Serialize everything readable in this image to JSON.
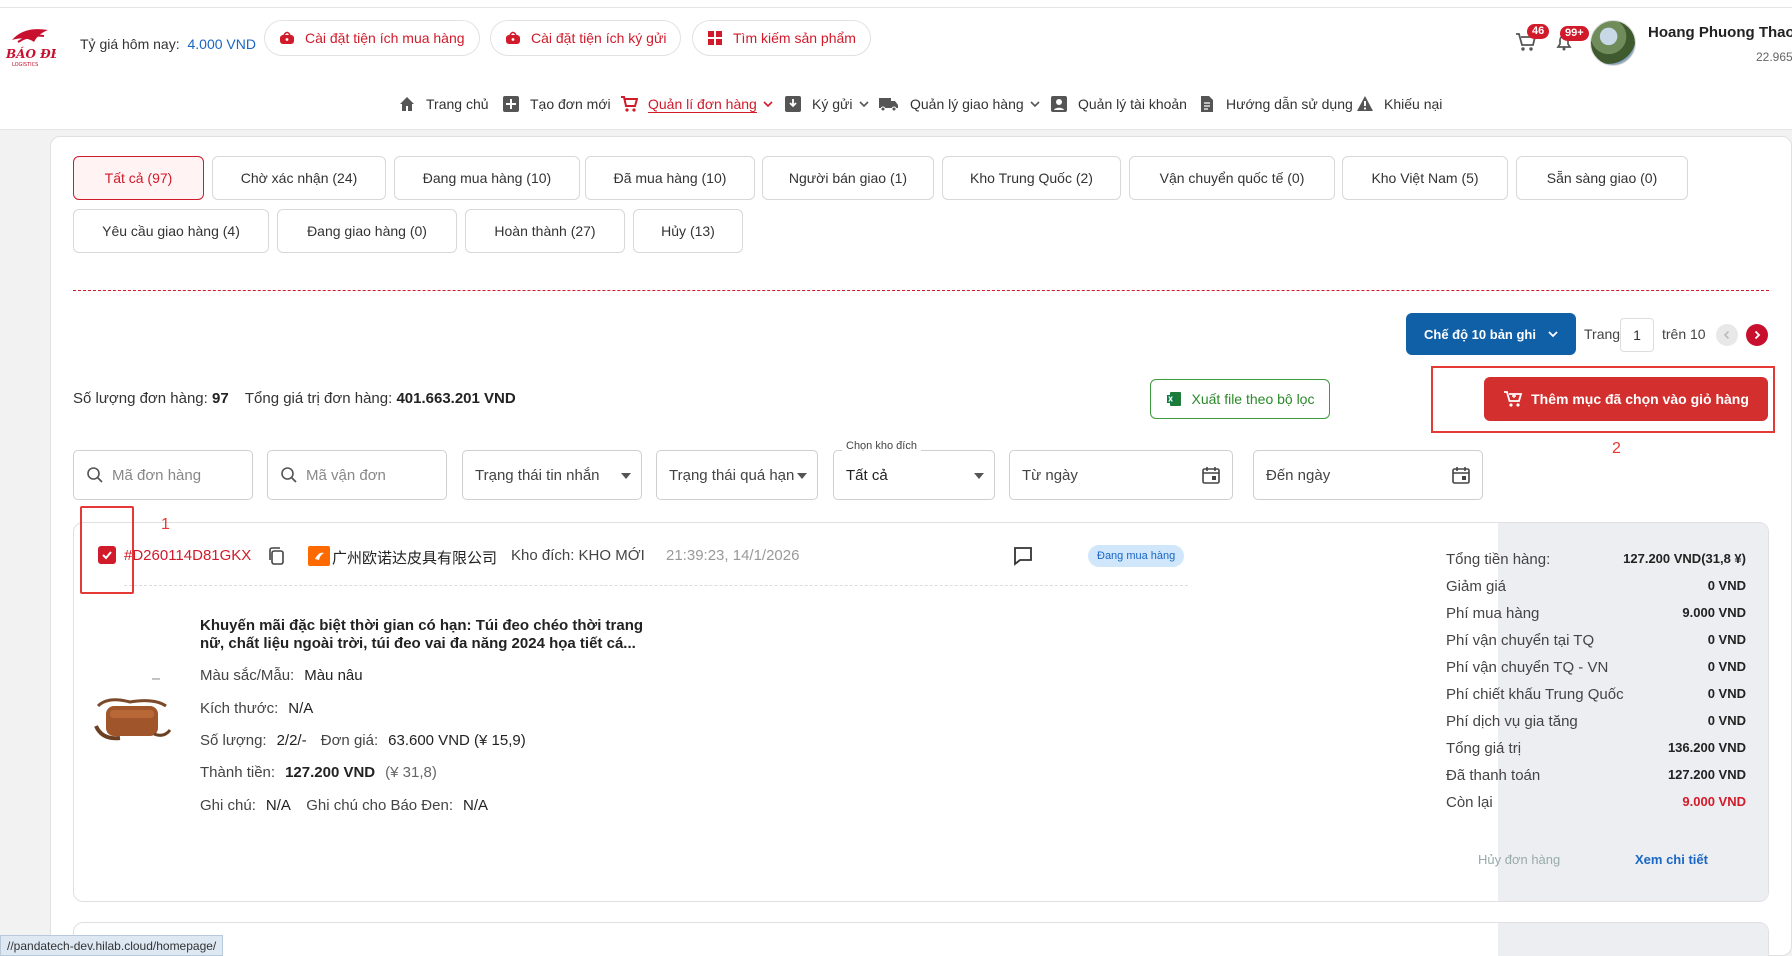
{
  "header": {
    "exchange_label": "Tỷ giá hôm nay:",
    "exchange_value": "4.000 VND",
    "pills": [
      "Cài đặt tiện ích mua hàng",
      "Cài đặt tiện ích ký gửi",
      "Tìm kiếm sản phẩm"
    ],
    "cart_badge": "46",
    "bell_badge": "99+",
    "username": "Hoang Phuong Thao",
    "balance": "22.965"
  },
  "nav": [
    {
      "label": "Trang chủ",
      "icon": "home-icon"
    },
    {
      "label": "Tạo đơn mới",
      "icon": "plus-square-icon"
    },
    {
      "label": "Quản lí đơn hàng",
      "icon": "cart-icon"
    },
    {
      "label": "Ký gửi",
      "icon": "download-box-icon"
    },
    {
      "label": "Quản lý giao hàng",
      "icon": "truck-icon"
    },
    {
      "label": "Quản lý tài khoản",
      "icon": "account-icon"
    },
    {
      "label": "Hướng dẫn sử dụng",
      "icon": "document-icon"
    },
    {
      "label": "Khiếu nại",
      "icon": "warning-icon"
    }
  ],
  "tabs": [
    "Tất cả (97)",
    "Chờ xác nhận (24)",
    "Đang mua hàng (10)",
    "Đã mua hàng (10)",
    "Người bán giao (1)",
    "Kho Trung Quốc (2)",
    "Vận chuyển quốc tế (0)",
    "Kho Việt Nam (5)",
    "Sẵn sàng giao (0)",
    "Yêu cầu giao hàng (4)",
    "Đang giao hàng (0)",
    "Hoàn thành (27)",
    "Hủy (13)"
  ],
  "pagination": {
    "mode_label": "Chế độ 10 bản ghi",
    "page_label": "Trang",
    "page_value": "1",
    "total_label": "trên 10"
  },
  "summary": {
    "count_label": "Số lượng đơn hàng:",
    "count_value": "97",
    "total_label": "Tổng giá trị đơn hàng:",
    "total_value": "401.663.201 VND"
  },
  "actions": {
    "export_label": "Xuất file theo bộ lọc",
    "add_cart_label": "Thêm mục đã chọn vào giỏ hàng"
  },
  "annotations": {
    "one": "1",
    "two": "2"
  },
  "filters": {
    "order_code_placeholder": "Mã đơn hàng",
    "tracking_placeholder": "Mã vận đơn",
    "message_status": "Trạng thái tin nhắn",
    "overdue_status": "Trạng thái quá hạn",
    "warehouse_legend": "Chọn kho đích",
    "warehouse_value": "Tất cả",
    "from_date": "Từ ngày",
    "to_date": "Đến ngày"
  },
  "order": {
    "id": "#D260114D81GKX",
    "shop_name": "广州欧诺达皮具有限公司",
    "destination": "Kho đích: KHO MỚI",
    "time": "21:39:23, 14/1/2026",
    "status": "Đang mua hàng",
    "product_title_1": "Khuyến mãi đặc biệt thời gian có hạn: Túi đeo chéo thời trang",
    "product_title_2": "nữ, chất liệu ngoài trời, túi đeo vai đa năng 2024 họa tiết cá...",
    "color_label": "Màu sắc/Mẫu:",
    "color_value": "Màu nâu",
    "size_label": "Kích thước:",
    "size_value": "N/A",
    "qty_label": "Số lượng:",
    "qty_value": "2/2/-",
    "unit_label": "Đơn giá:",
    "unit_value": "63.600 VND (¥ 15,9)",
    "subtotal_label": "Thành tiền:",
    "subtotal_value": "127.200 VND",
    "subtotal_cny": "(¥ 31,8)",
    "note_label": "Ghi chú:",
    "note_value": "N/A",
    "note_bd_label": "Ghi chú cho Báo Đen:",
    "note_bd_value": "N/A",
    "summary": [
      {
        "label": "Tổng tiền hàng:",
        "value": "127.200 VND(31,8 ¥)"
      },
      {
        "label": "Giảm giá",
        "value": "0 VND"
      },
      {
        "label": "Phí mua hàng",
        "value": "9.000 VND"
      },
      {
        "label": "Phí vận chuyển tại TQ",
        "value": "0 VND"
      },
      {
        "label": "Phí vận chuyển TQ - VN",
        "value": "0 VND"
      },
      {
        "label": "Phí chiết khấu Trung Quốc",
        "value": "0 VND"
      },
      {
        "label": "Phí dịch vụ gia tăng",
        "value": "0 VND"
      },
      {
        "label": "Tổng giá trị",
        "value": "136.200 VND"
      },
      {
        "label": "Đã thanh toán",
        "value": "127.200 VND"
      },
      {
        "label": "Còn lại",
        "value": "9.000 VND"
      }
    ],
    "cancel_label": "Hủy đơn hàng",
    "detail_label": "Xem chi tiết"
  },
  "status_url": "//pandatech-dev.hilab.cloud/homepage/",
  "colors": {
    "brand_red": "#d11a2a",
    "primary_blue": "#1060a8",
    "link_blue": "#1a66c4"
  }
}
